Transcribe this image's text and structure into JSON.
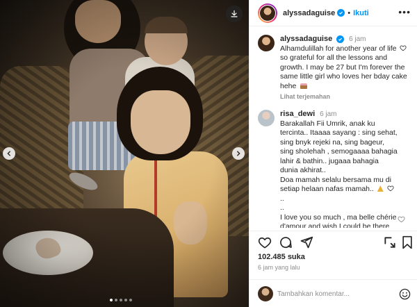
{
  "post": {
    "username": "alyssadaguise",
    "follow_label": "Ikuti",
    "separator": "•",
    "more_label": "•••",
    "caption": {
      "time": "6 jam",
      "lines": [
        "Alhamdulillah for another year of life",
        "so grateful for all the lessons and",
        "growth. I may be 27 but I'm forever the",
        "same little girl who loves her bday cake",
        "hehe"
      ],
      "translate_label": "Lihat terjemahan"
    },
    "comment": {
      "username": "risa_dewi",
      "time": "6 jam",
      "lines": [
        "Barakallah Fii Umrik, anak ku",
        "tercinta.. Itaaaa sayang : sing sehat,",
        "sing bnyk rejeki na, sing bageur,",
        "sing sholehah , semogaaaa bahagia",
        "lahir & bathin.. jugaaa bahagia",
        "dunia akhirat..",
        "Doa mamah selalu bersama mu di",
        "setiap helaan nafas mamah..",
        "..",
        "..",
        "I love you so much , ma belle chérie",
        "d'amour and wish I could be there"
      ]
    },
    "likes": "102.485 suka",
    "posted_ago": "6 jam yang lalu",
    "add_comment": {
      "placeholder": "Tambahkan komentar..."
    }
  },
  "carousel": {
    "slide_count": 5,
    "active_index": 0
  },
  "colors": {
    "accent": "#0095f6",
    "text": "#262626",
    "muted": "#8e8e8e",
    "border": "#efefef"
  },
  "icons": [
    "download-icon",
    "chevron-left-icon",
    "chevron-right-icon",
    "verified-badge-icon",
    "heart-icon",
    "comment-icon",
    "share-icon",
    "bookmark-icon",
    "emoji-icon"
  ]
}
